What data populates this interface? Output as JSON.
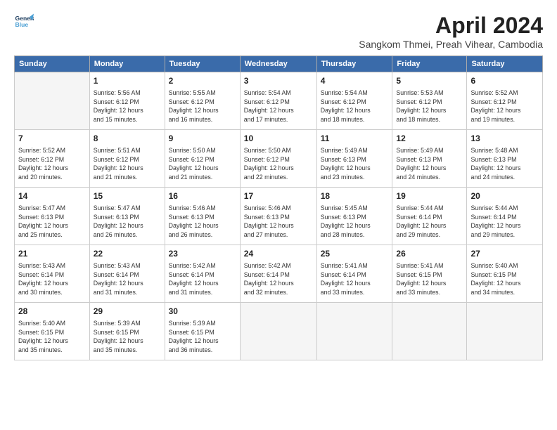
{
  "logo": {
    "line1": "General",
    "line2": "Blue"
  },
  "title": "April 2024",
  "subtitle": "Sangkom Thmei, Preah Vihear, Cambodia",
  "columns": [
    "Sunday",
    "Monday",
    "Tuesday",
    "Wednesday",
    "Thursday",
    "Friday",
    "Saturday"
  ],
  "weeks": [
    [
      {
        "day": "",
        "info": ""
      },
      {
        "day": "1",
        "info": "Sunrise: 5:56 AM\nSunset: 6:12 PM\nDaylight: 12 hours\nand 15 minutes."
      },
      {
        "day": "2",
        "info": "Sunrise: 5:55 AM\nSunset: 6:12 PM\nDaylight: 12 hours\nand 16 minutes."
      },
      {
        "day": "3",
        "info": "Sunrise: 5:54 AM\nSunset: 6:12 PM\nDaylight: 12 hours\nand 17 minutes."
      },
      {
        "day": "4",
        "info": "Sunrise: 5:54 AM\nSunset: 6:12 PM\nDaylight: 12 hours\nand 18 minutes."
      },
      {
        "day": "5",
        "info": "Sunrise: 5:53 AM\nSunset: 6:12 PM\nDaylight: 12 hours\nand 18 minutes."
      },
      {
        "day": "6",
        "info": "Sunrise: 5:52 AM\nSunset: 6:12 PM\nDaylight: 12 hours\nand 19 minutes."
      }
    ],
    [
      {
        "day": "7",
        "info": "Sunrise: 5:52 AM\nSunset: 6:12 PM\nDaylight: 12 hours\nand 20 minutes."
      },
      {
        "day": "8",
        "info": "Sunrise: 5:51 AM\nSunset: 6:12 PM\nDaylight: 12 hours\nand 21 minutes."
      },
      {
        "day": "9",
        "info": "Sunrise: 5:50 AM\nSunset: 6:12 PM\nDaylight: 12 hours\nand 21 minutes."
      },
      {
        "day": "10",
        "info": "Sunrise: 5:50 AM\nSunset: 6:12 PM\nDaylight: 12 hours\nand 22 minutes."
      },
      {
        "day": "11",
        "info": "Sunrise: 5:49 AM\nSunset: 6:13 PM\nDaylight: 12 hours\nand 23 minutes."
      },
      {
        "day": "12",
        "info": "Sunrise: 5:49 AM\nSunset: 6:13 PM\nDaylight: 12 hours\nand 24 minutes."
      },
      {
        "day": "13",
        "info": "Sunrise: 5:48 AM\nSunset: 6:13 PM\nDaylight: 12 hours\nand 24 minutes."
      }
    ],
    [
      {
        "day": "14",
        "info": "Sunrise: 5:47 AM\nSunset: 6:13 PM\nDaylight: 12 hours\nand 25 minutes."
      },
      {
        "day": "15",
        "info": "Sunrise: 5:47 AM\nSunset: 6:13 PM\nDaylight: 12 hours\nand 26 minutes."
      },
      {
        "day": "16",
        "info": "Sunrise: 5:46 AM\nSunset: 6:13 PM\nDaylight: 12 hours\nand 26 minutes."
      },
      {
        "day": "17",
        "info": "Sunrise: 5:46 AM\nSunset: 6:13 PM\nDaylight: 12 hours\nand 27 minutes."
      },
      {
        "day": "18",
        "info": "Sunrise: 5:45 AM\nSunset: 6:13 PM\nDaylight: 12 hours\nand 28 minutes."
      },
      {
        "day": "19",
        "info": "Sunrise: 5:44 AM\nSunset: 6:14 PM\nDaylight: 12 hours\nand 29 minutes."
      },
      {
        "day": "20",
        "info": "Sunrise: 5:44 AM\nSunset: 6:14 PM\nDaylight: 12 hours\nand 29 minutes."
      }
    ],
    [
      {
        "day": "21",
        "info": "Sunrise: 5:43 AM\nSunset: 6:14 PM\nDaylight: 12 hours\nand 30 minutes."
      },
      {
        "day": "22",
        "info": "Sunrise: 5:43 AM\nSunset: 6:14 PM\nDaylight: 12 hours\nand 31 minutes."
      },
      {
        "day": "23",
        "info": "Sunrise: 5:42 AM\nSunset: 6:14 PM\nDaylight: 12 hours\nand 31 minutes."
      },
      {
        "day": "24",
        "info": "Sunrise: 5:42 AM\nSunset: 6:14 PM\nDaylight: 12 hours\nand 32 minutes."
      },
      {
        "day": "25",
        "info": "Sunrise: 5:41 AM\nSunset: 6:14 PM\nDaylight: 12 hours\nand 33 minutes."
      },
      {
        "day": "26",
        "info": "Sunrise: 5:41 AM\nSunset: 6:15 PM\nDaylight: 12 hours\nand 33 minutes."
      },
      {
        "day": "27",
        "info": "Sunrise: 5:40 AM\nSunset: 6:15 PM\nDaylight: 12 hours\nand 34 minutes."
      }
    ],
    [
      {
        "day": "28",
        "info": "Sunrise: 5:40 AM\nSunset: 6:15 PM\nDaylight: 12 hours\nand 35 minutes."
      },
      {
        "day": "29",
        "info": "Sunrise: 5:39 AM\nSunset: 6:15 PM\nDaylight: 12 hours\nand 35 minutes."
      },
      {
        "day": "30",
        "info": "Sunrise: 5:39 AM\nSunset: 6:15 PM\nDaylight: 12 hours\nand 36 minutes."
      },
      {
        "day": "",
        "info": ""
      },
      {
        "day": "",
        "info": ""
      },
      {
        "day": "",
        "info": ""
      },
      {
        "day": "",
        "info": ""
      }
    ]
  ]
}
